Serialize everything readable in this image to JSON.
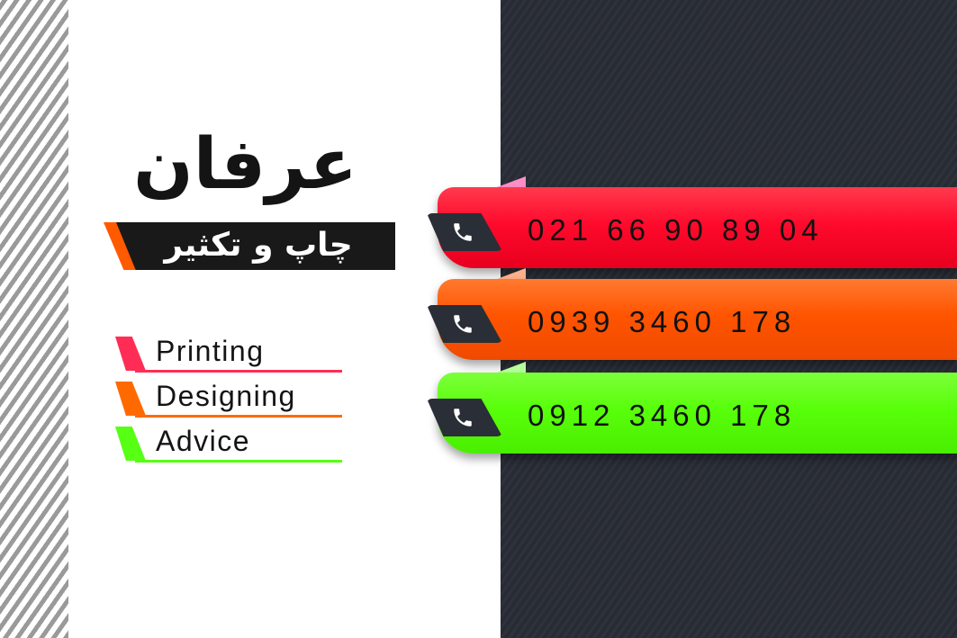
{
  "brand": {
    "name": "عرفان",
    "tagline": "چاپ و تکثیر"
  },
  "services": [
    {
      "label": "Printing",
      "color": "#ff2d55"
    },
    {
      "label": "Designing",
      "color": "#ff6a00"
    },
    {
      "label": "Advice",
      "color": "#57ff14"
    }
  ],
  "phones": [
    {
      "number": "021 66 90 89 04",
      "color": "#ff0a2c",
      "icon": "phone-icon"
    },
    {
      "number": "0939 3460 178",
      "color": "#ff5400",
      "icon": "phone-icon"
    },
    {
      "number": "0912 3460 178",
      "color": "#58ff0a",
      "icon": "phone-icon"
    }
  ],
  "colors": {
    "dark_panel": "#272b33",
    "stripe": "#9a9a9a",
    "tagline_bar": "#191919",
    "tagline_accent": "#ff5a00"
  }
}
